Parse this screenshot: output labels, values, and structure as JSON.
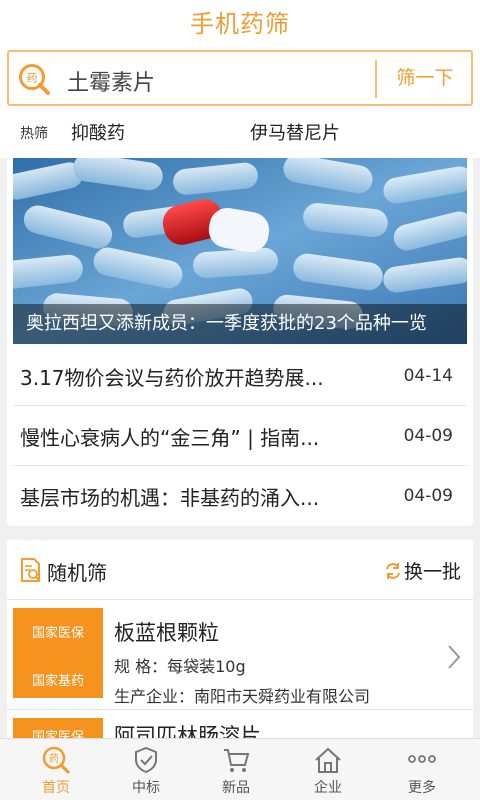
{
  "header": {
    "title": "手机药筛",
    "search": {
      "value": "土霉素片",
      "button": "筛一下"
    },
    "hot": {
      "label": "热筛",
      "tags": [
        "抑酸药",
        "伊马替尼片"
      ]
    }
  },
  "news": {
    "banner_caption": "奥拉西坦又添新成员：一季度获批的23个品种一览",
    "items": [
      {
        "title": "3.17物价会议与药价放开趋势展...",
        "date": "04-14"
      },
      {
        "title": "慢性心衰病人的“金三角” | 指南...",
        "date": "04-09"
      },
      {
        "title": "基层市场的机遇：非基药的涌入...",
        "date": "04-09"
      }
    ]
  },
  "random": {
    "title": "随机筛",
    "refresh": "换一批",
    "drugs": [
      {
        "badge1": "国家医保",
        "badge2": "国家基药",
        "name": "板蓝根颗粒",
        "spec": "规 格：每袋装10g",
        "maker": "生产企业：南阳市天舜药业有限公司"
      },
      {
        "badge1": "国家医保",
        "badge2": "",
        "name": "阿司匹林肠溶片",
        "spec": "",
        "maker": ""
      }
    ]
  },
  "tabbar": {
    "items": [
      {
        "label": "首页",
        "icon": "home-search-icon",
        "active": true
      },
      {
        "label": "中标",
        "icon": "shield-check-icon",
        "active": false
      },
      {
        "label": "新品",
        "icon": "cart-icon",
        "active": false
      },
      {
        "label": "企业",
        "icon": "building-icon",
        "active": false
      },
      {
        "label": "更多",
        "icon": "more-dots-icon",
        "active": false
      }
    ]
  },
  "colors": {
    "accent": "#f39c33",
    "badge": "#f6921e",
    "border": "#f7be72"
  }
}
